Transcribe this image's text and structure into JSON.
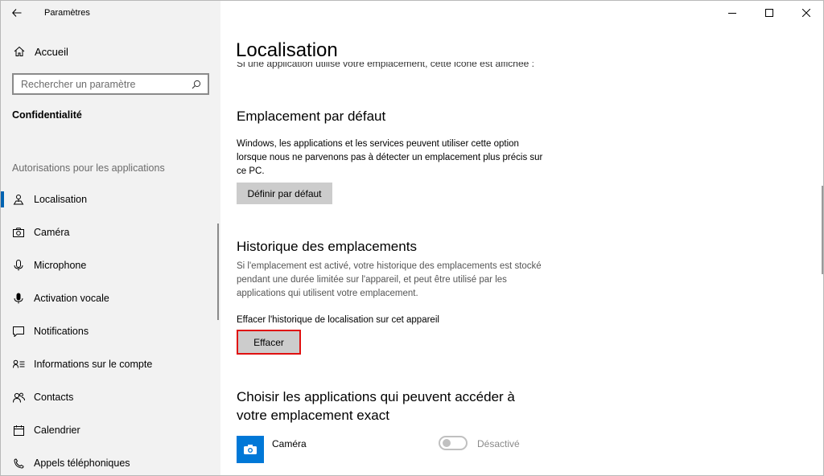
{
  "app": {
    "title": "Paramètres"
  },
  "sidebar": {
    "home_label": "Accueil",
    "search_placeholder": "Rechercher un paramètre",
    "section_title": "Confidentialité",
    "group_label": "Autorisations pour les applications",
    "items": [
      {
        "label": "Localisation",
        "icon": "location-icon",
        "selected": true
      },
      {
        "label": "Caméra",
        "icon": "camera-icon"
      },
      {
        "label": "Microphone",
        "icon": "microphone-icon"
      },
      {
        "label": "Activation vocale",
        "icon": "voice-activation-icon"
      },
      {
        "label": "Notifications",
        "icon": "notifications-icon"
      },
      {
        "label": "Informations sur le compte",
        "icon": "account-info-icon"
      },
      {
        "label": "Contacts",
        "icon": "contacts-icon"
      },
      {
        "label": "Calendrier",
        "icon": "calendar-icon"
      },
      {
        "label": "Appels téléphoniques",
        "icon": "phone-icon"
      }
    ]
  },
  "main": {
    "title": "Localisation",
    "cut_text": "Si une application utilise votre emplacement, cette icône est affichée :",
    "default_location": {
      "heading": "Emplacement par défaut",
      "description": "Windows, les applications et les services peuvent utiliser cette option lorsque nous ne parvenons pas à détecter un emplacement plus précis sur ce PC.",
      "button": "Définir par défaut"
    },
    "history": {
      "heading": "Historique des emplacements",
      "description": "Si l'emplacement est activé, votre historique des emplacements est stocké pendant une durée limitée sur l'appareil, et peut être utilisé par les applications qui utilisent votre emplacement.",
      "clear_label": "Effacer l'historique de localisation sur cet appareil",
      "button": "Effacer"
    },
    "apps": {
      "heading_line1": "Choisir les applications qui peuvent accéder à",
      "heading_line2": "votre emplacement exact",
      "list": [
        {
          "name": "Caméra",
          "state": "Désactivé",
          "on": false
        }
      ]
    }
  },
  "colors": {
    "accent": "#0063b1",
    "app_tile": "#0078d7",
    "highlight": "#e01010"
  }
}
